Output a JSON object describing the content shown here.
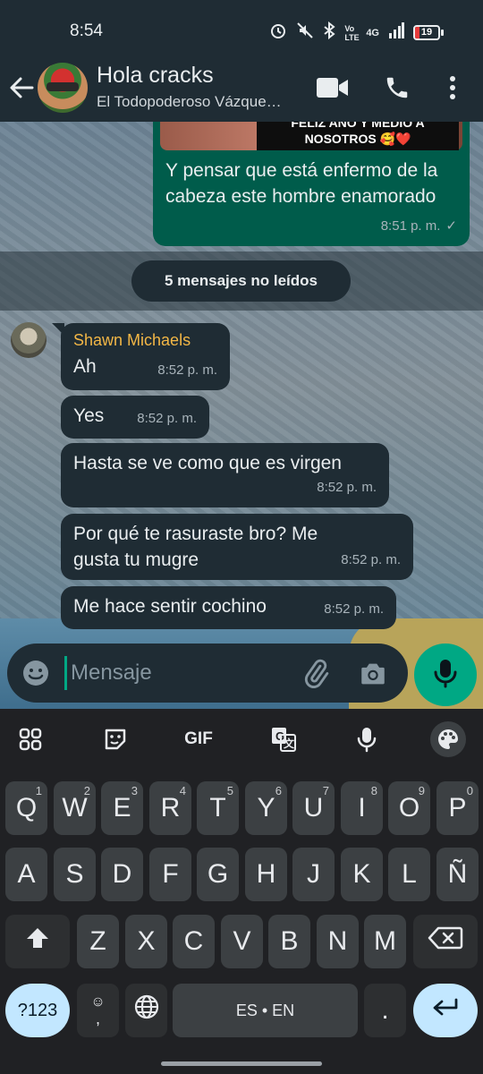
{
  "status_bar": {
    "time": "8:54",
    "network_label": "4G",
    "volte_label": "Vo LTE",
    "battery_level": "19",
    "battery_color": "#e63b3b"
  },
  "header": {
    "title": "Hola cracks",
    "subtitle": "El Todopoderoso Vázque…",
    "back_icon": "arrow-left-icon",
    "video_icon": "video-camera-icon",
    "call_icon": "phone-icon",
    "menu_icon": "more-vertical-icon"
  },
  "chat": {
    "outgoing": {
      "image_caption": "FELIZ AÑO Y MEDIO A NOSOTROS 🥰❤️",
      "text": "Y pensar que está enfermo de la cabeza este hombre enamorado",
      "time": "8:51 p. m.",
      "status_icon": "check-icon",
      "check": "✓"
    },
    "unread_label": "5 mensajes no leídos",
    "sender_name": "Shawn Michaels",
    "sender_color": "#f3b746",
    "messages": [
      {
        "text": "Ah",
        "time": "8:52 p. m."
      },
      {
        "text": "Yes",
        "time": "8:52 p. m."
      },
      {
        "text": "Hasta se ve como que es virgen",
        "time": "8:52 p. m."
      },
      {
        "text": "Por qué te rasuraste bro? Me gusta tu mugre",
        "time": "8:52 p. m."
      },
      {
        "text": "Me hace sentir cochino",
        "time": "8:52 p. m."
      }
    ]
  },
  "input": {
    "placeholder": "Mensaje",
    "value": "",
    "emoji_icon": "emoji-icon",
    "attach_icon": "paperclip-icon",
    "camera_icon": "camera-icon",
    "mic_icon": "microphone-icon",
    "accent_color": "#00a884"
  },
  "keyboard": {
    "toolbar": {
      "apps_icon": "grid-icon",
      "sticker_icon": "sticker-icon",
      "gif_label": "GIF",
      "translate_icon": "translate-icon",
      "voice_icon": "microphone-icon",
      "theme_icon": "palette-icon"
    },
    "row1": [
      {
        "key": "Q",
        "hint": "1"
      },
      {
        "key": "W",
        "hint": "2"
      },
      {
        "key": "E",
        "hint": "3"
      },
      {
        "key": "R",
        "hint": "4"
      },
      {
        "key": "T",
        "hint": "5"
      },
      {
        "key": "Y",
        "hint": "6"
      },
      {
        "key": "U",
        "hint": "7"
      },
      {
        "key": "I",
        "hint": "8"
      },
      {
        "key": "O",
        "hint": "9"
      },
      {
        "key": "P",
        "hint": "0"
      }
    ],
    "row2": [
      "A",
      "S",
      "D",
      "F",
      "G",
      "H",
      "J",
      "K",
      "L",
      "Ñ"
    ],
    "row3": [
      "Z",
      "X",
      "C",
      "V",
      "B",
      "N",
      "M"
    ],
    "shift_icon": "shift-arrow-icon",
    "backspace_icon": "backspace-icon",
    "symbols_label": "?123",
    "emoji_comma_label": ",",
    "globe_icon": "globe-icon",
    "space_label": "ES • EN",
    "period_label": ".",
    "enter_icon": "enter-icon"
  }
}
